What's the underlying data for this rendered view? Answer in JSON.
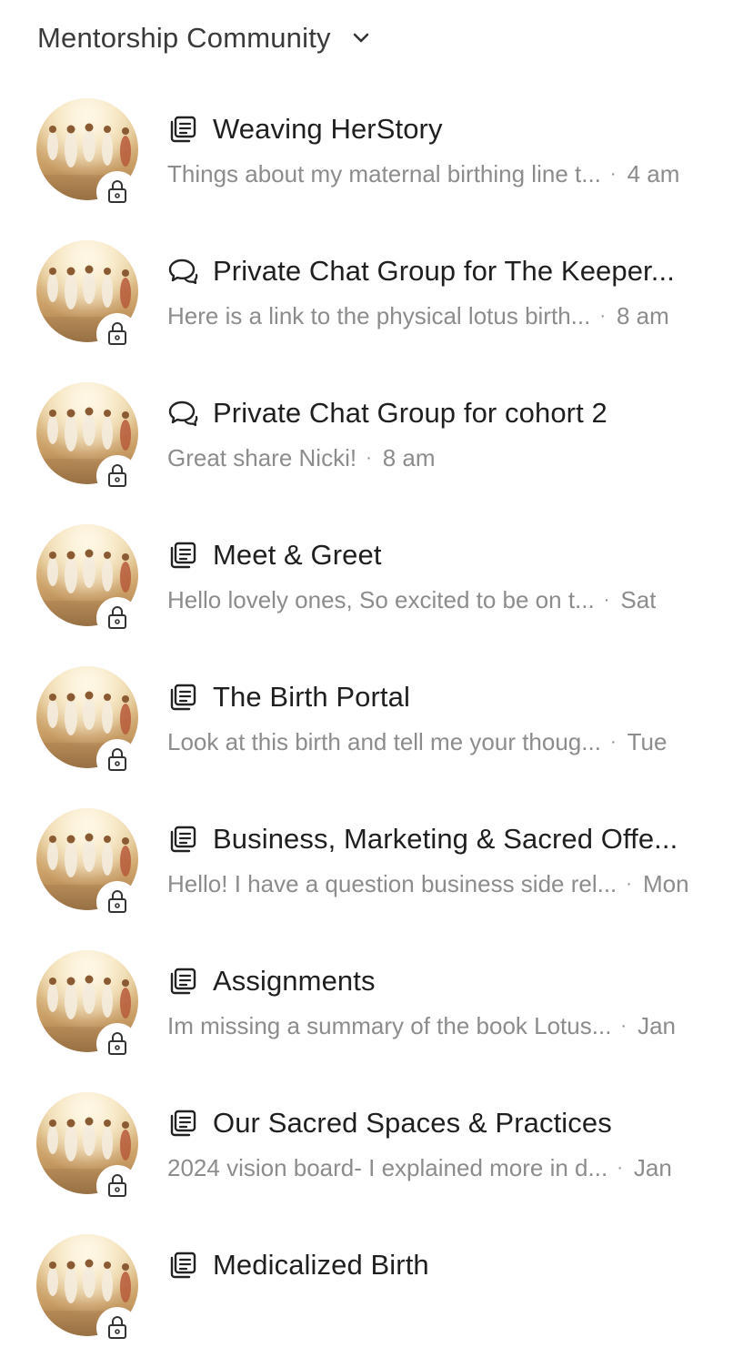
{
  "header": {
    "title": "Mentorship Community",
    "chevron_icon": "chevron-down-icon"
  },
  "colors": {
    "title_text": "#1f1f1f",
    "secondary_text": "#8c8c8c",
    "background": "#ffffff"
  },
  "spaces": [
    {
      "type_icon": "post-list-icon",
      "title": "Weaving HerStory",
      "snippet": "Things about my maternal birthing line t...",
      "time": "4 am",
      "locked": true
    },
    {
      "type_icon": "chat-bubbles-icon",
      "title": "Private Chat Group for The Keeper...",
      "snippet": "Here is a link to the physical lotus birth...",
      "time": "8 am",
      "locked": true
    },
    {
      "type_icon": "chat-bubbles-icon",
      "title": "Private Chat Group for cohort 2",
      "snippet": "Great share Nicki!",
      "time": "8 am",
      "locked": true
    },
    {
      "type_icon": "post-list-icon",
      "title": "Meet & Greet",
      "snippet": "Hello lovely ones,    So excited to be on t...",
      "time": "Sat",
      "locked": true
    },
    {
      "type_icon": "post-list-icon",
      "title": "The Birth Portal",
      "snippet": "Look at this birth and tell me your thoug...",
      "time": "Tue",
      "locked": true
    },
    {
      "type_icon": "post-list-icon",
      "title": "Business, Marketing & Sacred Offe...",
      "snippet": "Hello! I have a question business side rel...",
      "time": "Mon",
      "locked": true
    },
    {
      "type_icon": "post-list-icon",
      "title": "Assignments",
      "snippet": "Im missing a summary of the book Lotus...",
      "time": "Jan",
      "locked": true
    },
    {
      "type_icon": "post-list-icon",
      "title": "Our Sacred Spaces & Practices",
      "snippet": "2024 vision board- I explained more in d...",
      "time": "Jan",
      "locked": true
    },
    {
      "type_icon": "post-list-icon",
      "title": "Medicalized Birth",
      "snippet": "",
      "time": "",
      "locked": true
    }
  ]
}
